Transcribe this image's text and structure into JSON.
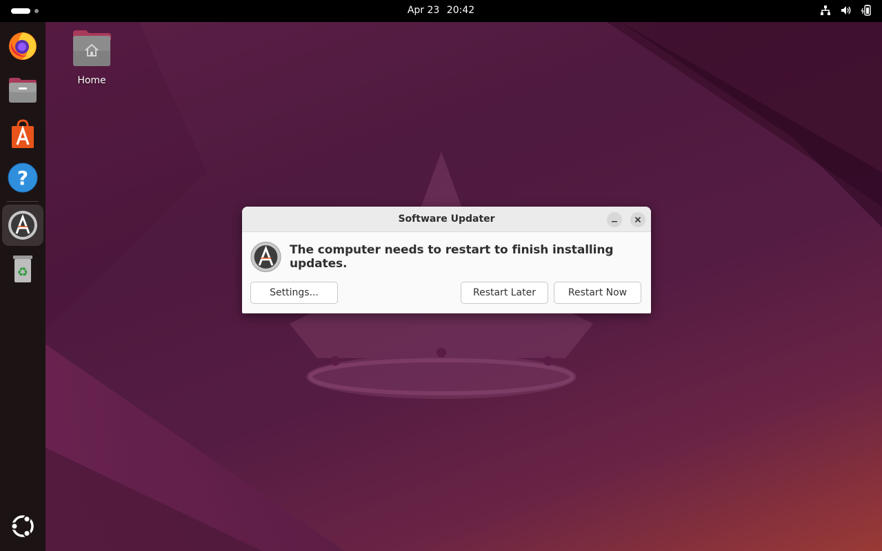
{
  "topbar": {
    "date": "Apr 23",
    "time": "20:42",
    "tray_icons": [
      "network-icon",
      "volume-icon",
      "battery-icon"
    ]
  },
  "dock": {
    "items": [
      {
        "name": "firefox",
        "icon": "firefox-icon"
      },
      {
        "name": "files",
        "icon": "files-icon"
      },
      {
        "name": "app-center",
        "icon": "app-center-icon"
      },
      {
        "name": "help",
        "icon": "help-icon"
      },
      {
        "name": "software-updater",
        "icon": "software-updater-icon",
        "active": true
      },
      {
        "name": "trash",
        "icon": "trash-icon"
      }
    ],
    "show_apps_icon": "ubuntu-logo-icon"
  },
  "desktop": {
    "home_label": "Home"
  },
  "dialog": {
    "title": "Software Updater",
    "message": "The computer needs to restart to finish installing updates.",
    "settings_label": "Settings...",
    "restart_later_label": "Restart Later",
    "restart_now_label": "Restart Now"
  },
  "colors": {
    "accent": "#e9541b",
    "topbar": "#000000",
    "dock": "#1c1414",
    "dialog_bg": "#fafafa"
  }
}
